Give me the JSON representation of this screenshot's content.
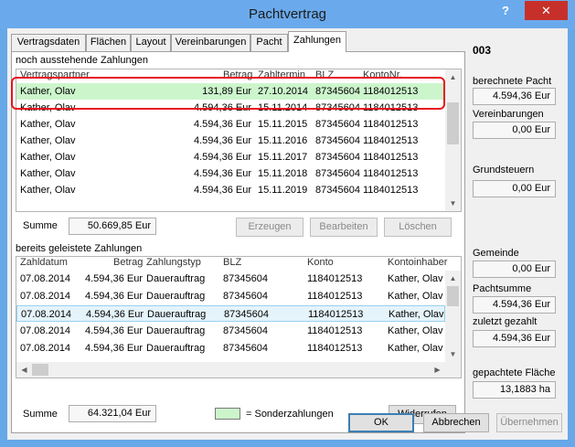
{
  "window": {
    "title": "Pachtvertrag",
    "help_glyph": "?",
    "close_glyph": "✕"
  },
  "tabs": [
    {
      "label": "Vertragsdaten"
    },
    {
      "label": "Flächen"
    },
    {
      "label": "Layout"
    },
    {
      "label": "Vereinbarungen"
    },
    {
      "label": "Pacht"
    },
    {
      "label": "Zahlungen",
      "active": true
    }
  ],
  "outstanding": {
    "section_label": "noch ausstehende Zahlungen",
    "columns": [
      "Vertragspartner",
      "Betrag",
      "Zahltermin",
      "BLZ",
      "KontoNr."
    ],
    "rows": [
      {
        "partner": "Kather, Olav",
        "betrag": "131,89 Eur",
        "termin": "27.10.2014",
        "blz": "87345604",
        "konto": "1184012513",
        "special": true
      },
      {
        "partner": "Kather, Olav",
        "betrag": "4.594,36 Eur",
        "termin": "15.11.2014",
        "blz": "87345604",
        "konto": "1184012513"
      },
      {
        "partner": "Kather, Olav",
        "betrag": "4.594,36 Eur",
        "termin": "15.11.2015",
        "blz": "87345604",
        "konto": "1184012513"
      },
      {
        "partner": "Kather, Olav",
        "betrag": "4.594,36 Eur",
        "termin": "15.11.2016",
        "blz": "87345604",
        "konto": "1184012513"
      },
      {
        "partner": "Kather, Olav",
        "betrag": "4.594,36 Eur",
        "termin": "15.11.2017",
        "blz": "87345604",
        "konto": "1184012513"
      },
      {
        "partner": "Kather, Olav",
        "betrag": "4.594,36 Eur",
        "termin": "15.11.2018",
        "blz": "87345604",
        "konto": "1184012513"
      },
      {
        "partner": "Kather, Olav",
        "betrag": "4.594,36 Eur",
        "termin": "15.11.2019",
        "blz": "87345604",
        "konto": "1184012513"
      }
    ],
    "sum_label": "Summe",
    "sum_value": "50.669,85 Eur",
    "buttons": {
      "create": "Erzeugen",
      "edit": "Bearbeiten",
      "delete": "Löschen"
    }
  },
  "paid": {
    "section_label": "bereits geleistete Zahlungen",
    "columns": [
      "Zahldatum",
      "Betrag",
      "Zahlungstyp",
      "BLZ",
      "Konto",
      "Kontoinhaber"
    ],
    "rows": [
      {
        "datum": "07.08.2014",
        "betrag": "4.594,36 Eur",
        "typ": "Dauerauftrag",
        "blz": "87345604",
        "konto": "1184012513",
        "inhaber": "Kather, Olav"
      },
      {
        "datum": "07.08.2014",
        "betrag": "4.594,36 Eur",
        "typ": "Dauerauftrag",
        "blz": "87345604",
        "konto": "1184012513",
        "inhaber": "Kather, Olav"
      },
      {
        "datum": "07.08.2014",
        "betrag": "4.594,36 Eur",
        "typ": "Dauerauftrag",
        "blz": "87345604",
        "konto": "1184012513",
        "inhaber": "Kather, Olav",
        "selected": true
      },
      {
        "datum": "07.08.2014",
        "betrag": "4.594,36 Eur",
        "typ": "Dauerauftrag",
        "blz": "87345604",
        "konto": "1184012513",
        "inhaber": "Kather, Olav"
      },
      {
        "datum": "07.08.2014",
        "betrag": "4.594,36 Eur",
        "typ": "Dauerauftrag",
        "blz": "87345604",
        "konto": "1184012513",
        "inhaber": "Kather, Olav"
      }
    ],
    "sum_label": "Summe",
    "sum_value": "64.321,04 Eur",
    "legend_label": "= Sonderzahlungen",
    "revoke_button": "Widerrufen"
  },
  "sidebar": {
    "id": "003",
    "calc_label": "berechnete Pacht",
    "calc_value": "4.594,36 Eur",
    "agreements_label": "Vereinbarungen",
    "agreements_value": "0,00 Eur",
    "landtax_label": "Grundsteuern",
    "landtax_value": "0,00 Eur",
    "municipality_label": "Gemeinde",
    "municipality_value": "0,00 Eur",
    "lease_sum_label": "Pachtsumme",
    "lease_sum_value": "4.594,36 Eur",
    "last_paid_label": "zuletzt gezahlt",
    "last_paid_value": "4.594,36 Eur",
    "area_label": "gepachtete Fläche",
    "area_value": "13,1883 ha"
  },
  "footer": {
    "ok": "OK",
    "cancel": "Abbrechen",
    "apply": "Übernehmen"
  },
  "colors": {
    "titlebar": "#6aaaec",
    "close": "#c7302a",
    "special_row": "#ccf5cc",
    "highlight": "#e8141d"
  }
}
